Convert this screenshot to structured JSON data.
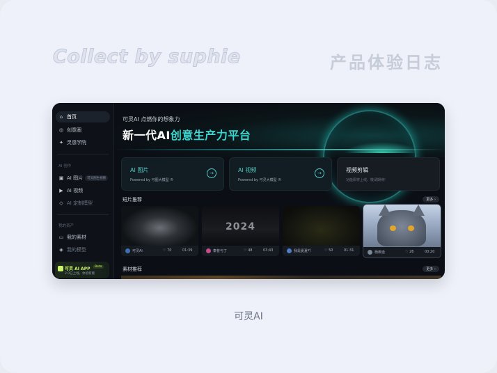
{
  "watermark": "Collect by suphie",
  "header_title": "产品体验日志",
  "caption": "可灵AI",
  "sidebar": {
    "items": [
      {
        "label": "首页",
        "icon": "home-icon"
      },
      {
        "label": "创意圈",
        "icon": "globe-icon"
      },
      {
        "label": "灵感学院",
        "icon": "spark-icon"
      }
    ],
    "section_create": "AI 创作",
    "create_items": [
      {
        "label": "AI 图片",
        "icon": "image-icon",
        "badge": "可灵图生视频"
      },
      {
        "label": "AI 视频",
        "icon": "video-icon"
      },
      {
        "label": "AI 定制模型",
        "icon": "model-icon"
      }
    ],
    "section_assets": "我的资产",
    "asset_items": [
      {
        "label": "我的素材",
        "icon": "folder-icon"
      },
      {
        "label": "我的模型",
        "icon": "cube-icon"
      }
    ],
    "promo": {
      "title": "可灵 AI APP",
      "tag": "Beta",
      "sub": "2.0已上线，体验新版"
    }
  },
  "hero": {
    "slogan": "可灵AI 点燃你的想象力",
    "headline_prefix": "新一代AI",
    "headline_accent": "创意生产力平台"
  },
  "cards": [
    {
      "title": "AI 图片",
      "sub": "Powered by 可图大模型 ®"
    },
    {
      "title": "AI 视频",
      "sub": "Powered by 可灵大模型 ®"
    },
    {
      "title": "视频剪辑",
      "sub": "功能即将上线，敬请期待!"
    }
  ],
  "short_section": {
    "title": "短片推荐",
    "more": "更多 ›"
  },
  "videos": [
    {
      "author": "可灵Ai",
      "likes": "70",
      "duration": "01:39",
      "avatar_color": "#3f6fb4"
    },
    {
      "author": "泰普与丁",
      "likes": "48",
      "duration": "03:43",
      "avatar_color": "#c64c8c",
      "overlay": "2024"
    },
    {
      "author": "我是夏夏吖",
      "likes": "50",
      "duration": "01:31",
      "avatar_color": "#4f7cc9"
    },
    {
      "author": "杨枫逸",
      "likes": "26",
      "duration": "00:20",
      "avatar_color": "#7a8797"
    }
  ],
  "material_section": {
    "title": "素材推荐",
    "more": "更多 ›"
  }
}
